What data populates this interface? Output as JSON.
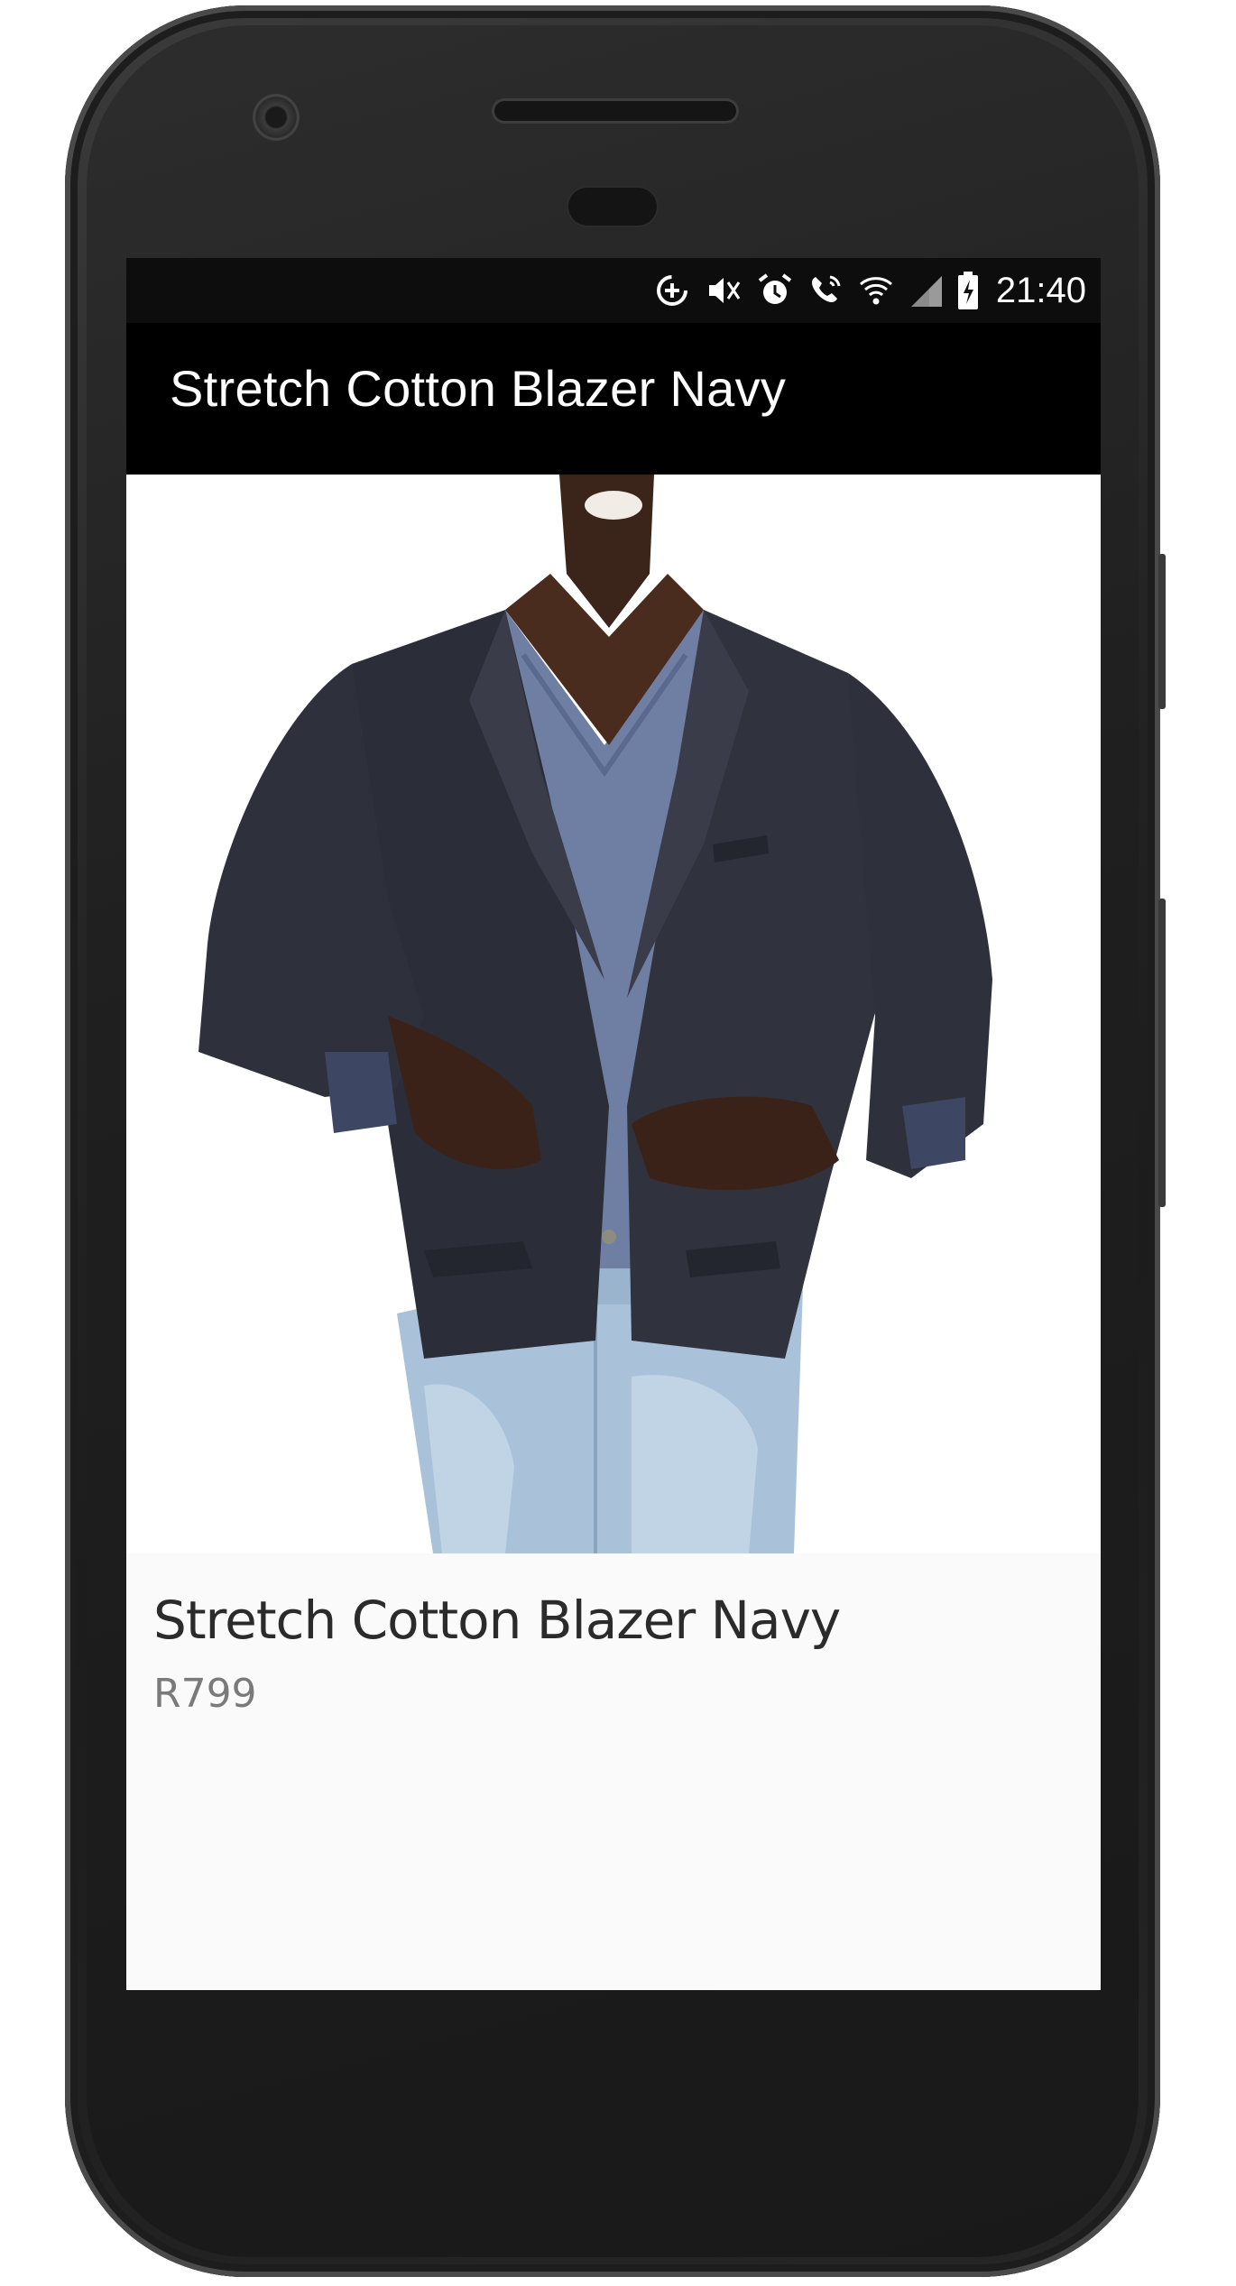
{
  "status_bar": {
    "time": "21:40",
    "icons": [
      "data-saver-icon",
      "vibrate-icon",
      "alarm-icon",
      "wifi-calling-icon",
      "wifi-icon",
      "signal-icon",
      "battery-charging-icon"
    ]
  },
  "app_bar": {
    "title": "Stretch Cotton Blazer Navy"
  },
  "product": {
    "image_alt": "Model wearing stretch cotton navy blazer over grey v-neck tee and light blue jeans",
    "name": "Stretch Cotton Blazer Navy",
    "price": "R799"
  },
  "colors": {
    "status_bar_bg": "#0d0d0d",
    "app_bar_bg": "#000000",
    "screen_bg": "#fafafa",
    "title_text": "#ffffff",
    "name_text": "#2b2b2b",
    "price_text": "#7a7a7a"
  }
}
